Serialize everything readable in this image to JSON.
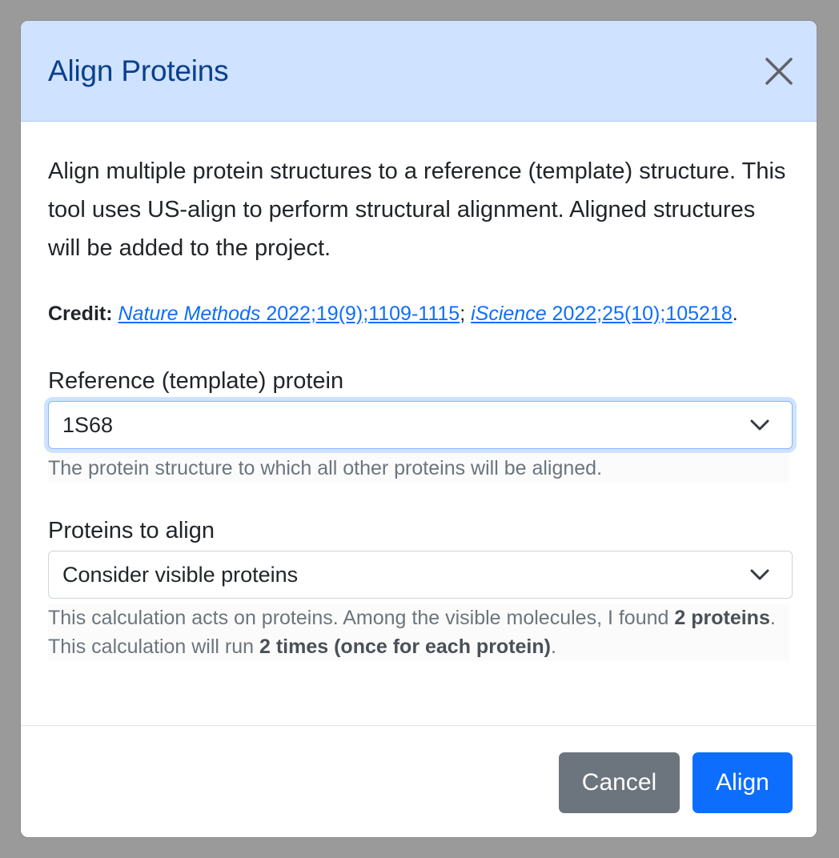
{
  "modal": {
    "title": "Align Proteins",
    "close_icon": "close-icon"
  },
  "body": {
    "intro": "Align multiple protein structures to a reference (template) structure. This tool uses US-align to perform structural alignment. Aligned structures will be added to the project.",
    "credit": {
      "label": "Credit:",
      "ref1_journal": "Nature Methods",
      "ref1_citation": " 2022;19(9);1109-1115",
      "separator": "; ",
      "ref2_journal": "iScience",
      "ref2_citation": " 2022;25(10);105218",
      "end": "."
    },
    "reference": {
      "label": "Reference (template) protein",
      "selected": "1S68",
      "help": "The protein structure to which all other proteins will be aligned."
    },
    "proteins": {
      "label": "Proteins to align",
      "selected": "Consider visible proteins",
      "help_part1": "This calculation acts on proteins. Among the visible molecules, I found ",
      "help_bold1": "2 proteins",
      "help_part2": ". This calculation will run ",
      "help_bold2": "2 times (once for each protein)",
      "help_part3": "."
    }
  },
  "footer": {
    "cancel_label": "Cancel",
    "align_label": "Align"
  },
  "colors": {
    "header_bg": "#cfe2ff",
    "title": "#0a3f8c",
    "primary": "#0d6efd",
    "secondary": "#6c757d"
  }
}
